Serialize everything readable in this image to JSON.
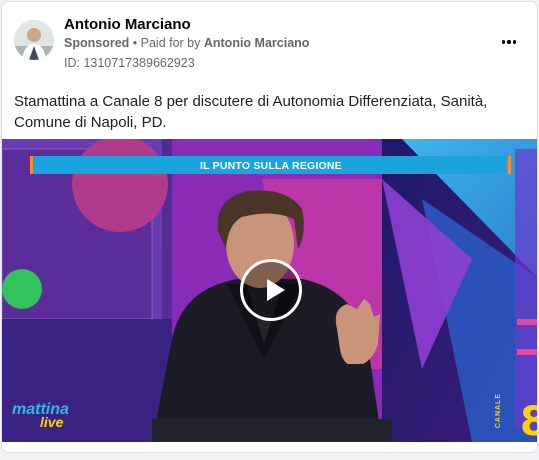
{
  "post": {
    "author": "Antonio Marciano",
    "sponsored_label": "Sponsored",
    "separator": " • ",
    "paid_for_prefix": "Paid for by ",
    "paid_for_name": "Antonio Marciano",
    "ad_id": "ID: 1310717389662923",
    "caption": "Stamattina a Canale 8 per discutere di Autonomia Differenziata, Sanità, Comune di Napoli, PD."
  },
  "video": {
    "banner_text": "IL PUNTO SULLA REGIONE",
    "logo_left_line1": "mattina",
    "logo_left_line2": "live",
    "logo_right_text": "CANALE",
    "logo_right_number": "8"
  },
  "icons": {
    "more": "more-options-icon",
    "play": "play-icon"
  },
  "colors": {
    "accent_purple": "#7b3fd0",
    "banner_cyan": "#1aa3dc",
    "brand_yellow": "#ffd200",
    "text_secondary": "#65676b"
  }
}
